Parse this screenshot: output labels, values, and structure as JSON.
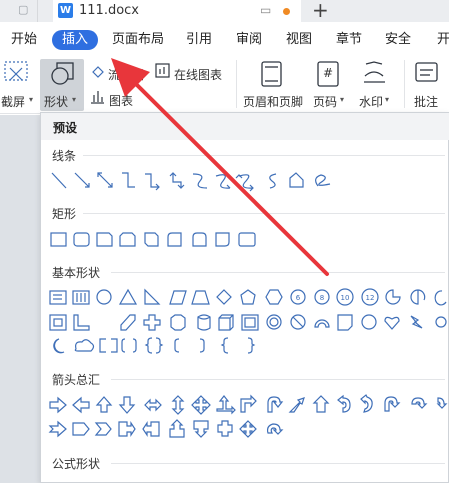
{
  "titlebar": {
    "doc_title": "111.docx",
    "doc_icon_letter": "W",
    "new_tab": "+"
  },
  "menu": {
    "items": [
      "开始",
      "插入",
      "页面布局",
      "引用",
      "审阅",
      "视图",
      "章节",
      "安全",
      "开"
    ],
    "active": "插入"
  },
  "ribbon": {
    "screenshot": "截屏",
    "shape": "形状",
    "flowchart": "流程图",
    "online_chart": "在线图表",
    "chart": "图表",
    "header_footer": "页眉和页脚",
    "page_number": "页码",
    "watermark": "水印",
    "comment": "批注",
    "page_number_field": "#"
  },
  "panel": {
    "preset": "预设",
    "sections": {
      "lines": "线条",
      "rectangles": "矩形",
      "basic": "基本形状",
      "arrows": "箭头总汇",
      "formula": "公式形状"
    },
    "basic_shape_labels": [
      "6",
      "8",
      "10",
      "12"
    ]
  },
  "colors": {
    "accent": "#2f6fe0",
    "shape_stroke": "#3f6fb8",
    "annotation_arrow": "#e8363b"
  }
}
